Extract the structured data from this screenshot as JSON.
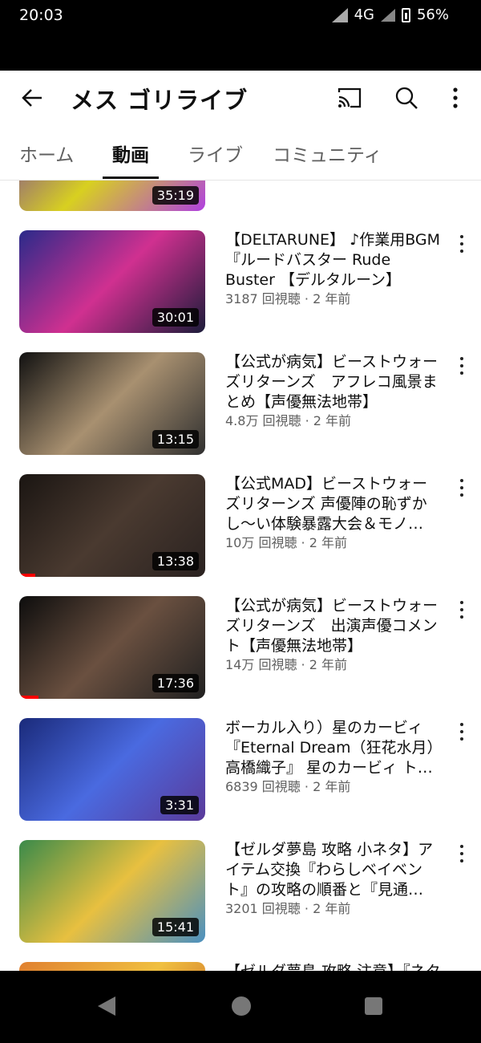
{
  "status": {
    "time": "20:03",
    "network": "4G",
    "battery": "56%"
  },
  "header": {
    "title": "メス ゴリライブ"
  },
  "tabs": [
    {
      "label": "ホーム"
    },
    {
      "label": "動画"
    },
    {
      "label": "ライブ"
    },
    {
      "label": "コミュニティ"
    }
  ],
  "active_tab": "動画",
  "videos": [
    {
      "title": "",
      "meta": "",
      "duration": "35:19",
      "colors": [
        "#6a2fb0",
        "#d8d020",
        "#b040e0"
      ]
    },
    {
      "title": "【DELTARUNE】 ♪作業用BGM『ルードバスター Rude Buster 【デルタルーン】",
      "meta": "3187 回視聴 · 2 年前",
      "duration": "30:01",
      "colors": [
        "#2a2a8a",
        "#d03090",
        "#1c1c3a"
      ]
    },
    {
      "title": "【公式が病気】ビーストウォーズリターンズ　アフレコ風景まとめ【声優無法地帯】",
      "meta": "4.8万 回視聴 · 2 年前",
      "duration": "13:15",
      "colors": [
        "#111111",
        "#a89070",
        "#303030"
      ]
    },
    {
      "title": "【公式MAD】ビーストウォーズリターンズ 声優陣の恥ずかし～い体験暴露大会＆モノ…",
      "meta": "10万 回視聴 · 2 年前",
      "duration": "13:38",
      "colors": [
        "#1a1512",
        "#4a3a30",
        "#2a2220"
      ]
    },
    {
      "title": "【公式が病気】ビーストウォーズリターンズ　出演声優コメント【声優無法地帯】",
      "meta": "14万 回視聴 · 2 年前",
      "duration": "17:36",
      "colors": [
        "#0d0d0d",
        "#6a5040",
        "#202020"
      ]
    },
    {
      "title": "ボーカル入り）星のカービィ『Eternal Dream（狂花水月）高橋織子』 星のカービィ ト…",
      "meta": "6839 回視聴 · 2 年前",
      "duration": "3:31",
      "colors": [
        "#1a2a7a",
        "#4a6ae0",
        "#5a3a9a"
      ]
    },
    {
      "title": "【ゼルダ夢島 攻略 小ネタ】アイテム交換『わらしベイベント』の攻略の順番と『見通…",
      "meta": "3201 回視聴 · 2 年前",
      "duration": "15:41",
      "colors": [
        "#3a8a4a",
        "#e8c040",
        "#4a90c0"
      ]
    },
    {
      "title": "【ゼルダ夢島 攻略 注意】『ネタバレ…",
      "meta": "",
      "duration": "",
      "colors": [
        "#e08030",
        "#f0c040",
        "#c05020"
      ]
    }
  ]
}
